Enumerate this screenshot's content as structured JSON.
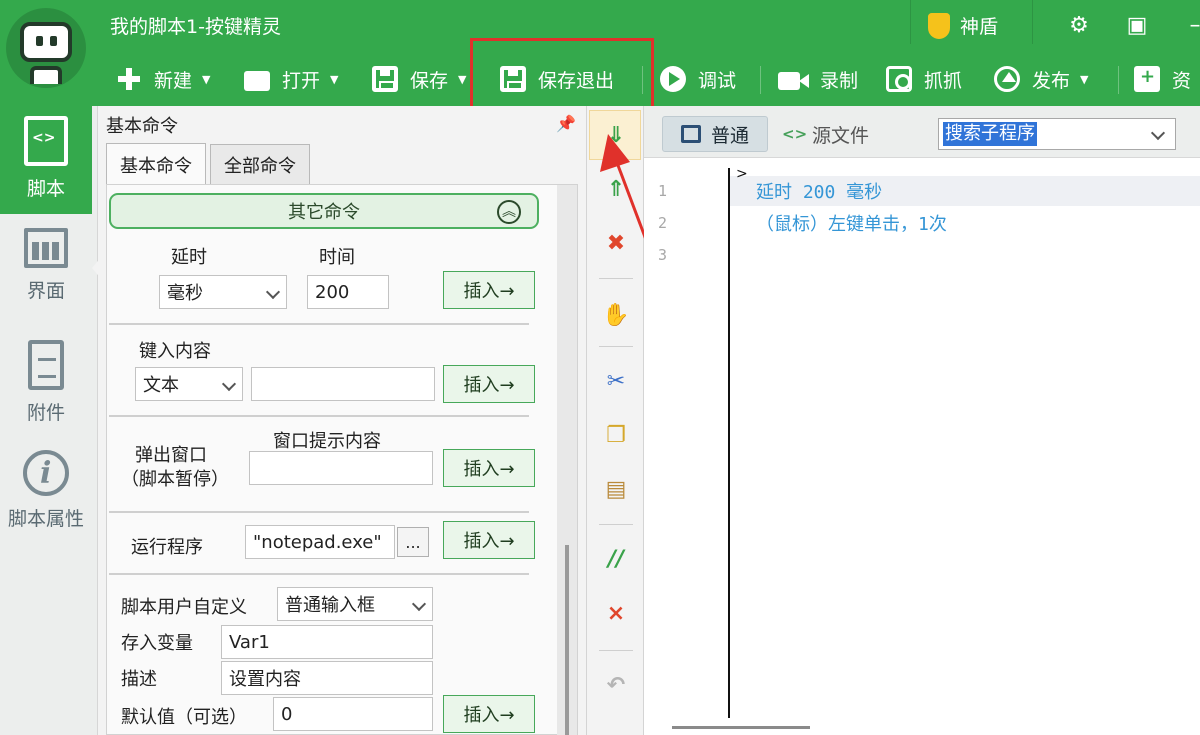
{
  "app": {
    "title": "我的脚本1-按键精灵",
    "shield_label": "神盾"
  },
  "toolbar": {
    "new_label": "新建",
    "open_label": "打开",
    "save_label": "保存",
    "save_exit_label": "保存退出",
    "debug_label": "调试",
    "record_label": "录制",
    "grab_label": "抓抓",
    "publish_label": "发布",
    "resource_label": "资"
  },
  "sidebar": {
    "items": [
      {
        "label": "脚本",
        "icon": "script-icon",
        "active": true
      },
      {
        "label": "界面",
        "icon": "interface-icon",
        "active": false
      },
      {
        "label": "附件",
        "icon": "attachment-icon",
        "active": false
      },
      {
        "label": "脚本属性",
        "icon": "info-icon",
        "active": false
      }
    ]
  },
  "panel": {
    "title": "基本命令",
    "tabs": [
      "基本命令",
      "全部命令"
    ],
    "section_title": "其它命令",
    "delay": {
      "label": "延时",
      "time_label": "时间",
      "unit_value": "毫秒",
      "time_value": "200"
    },
    "keyin": {
      "label": "键入内容",
      "type_value": "文本",
      "text_value": ""
    },
    "popup": {
      "label_line1": "弹出窗口",
      "label_line2": "（脚本暂停）",
      "content_label": "窗口提示内容",
      "content_value": ""
    },
    "run": {
      "label": "运行程序",
      "value": "\"notepad.exe\"",
      "browse_label": "..."
    },
    "custom": {
      "label": "脚本用户自定义",
      "type_value": "普通输入框",
      "var_label": "存入变量",
      "var_value": "Var1",
      "desc_label": "描述",
      "desc_value": "设置内容",
      "default_label": "默认值（可选）",
      "default_value": "0"
    },
    "insert_label": "插入→"
  },
  "editor": {
    "mode_normal": "普通",
    "mode_source": "源文件",
    "search_sub": "搜索子程序",
    "line_numbers": [
      "1",
      "2",
      "3"
    ],
    "lines": [
      "延时 200 毫秒",
      "（鼠标）左键单击，1次"
    ]
  },
  "colors": {
    "brand_green": "#34a94c",
    "highlight_red": "#e0312b",
    "code_blue": "#3596d6"
  }
}
